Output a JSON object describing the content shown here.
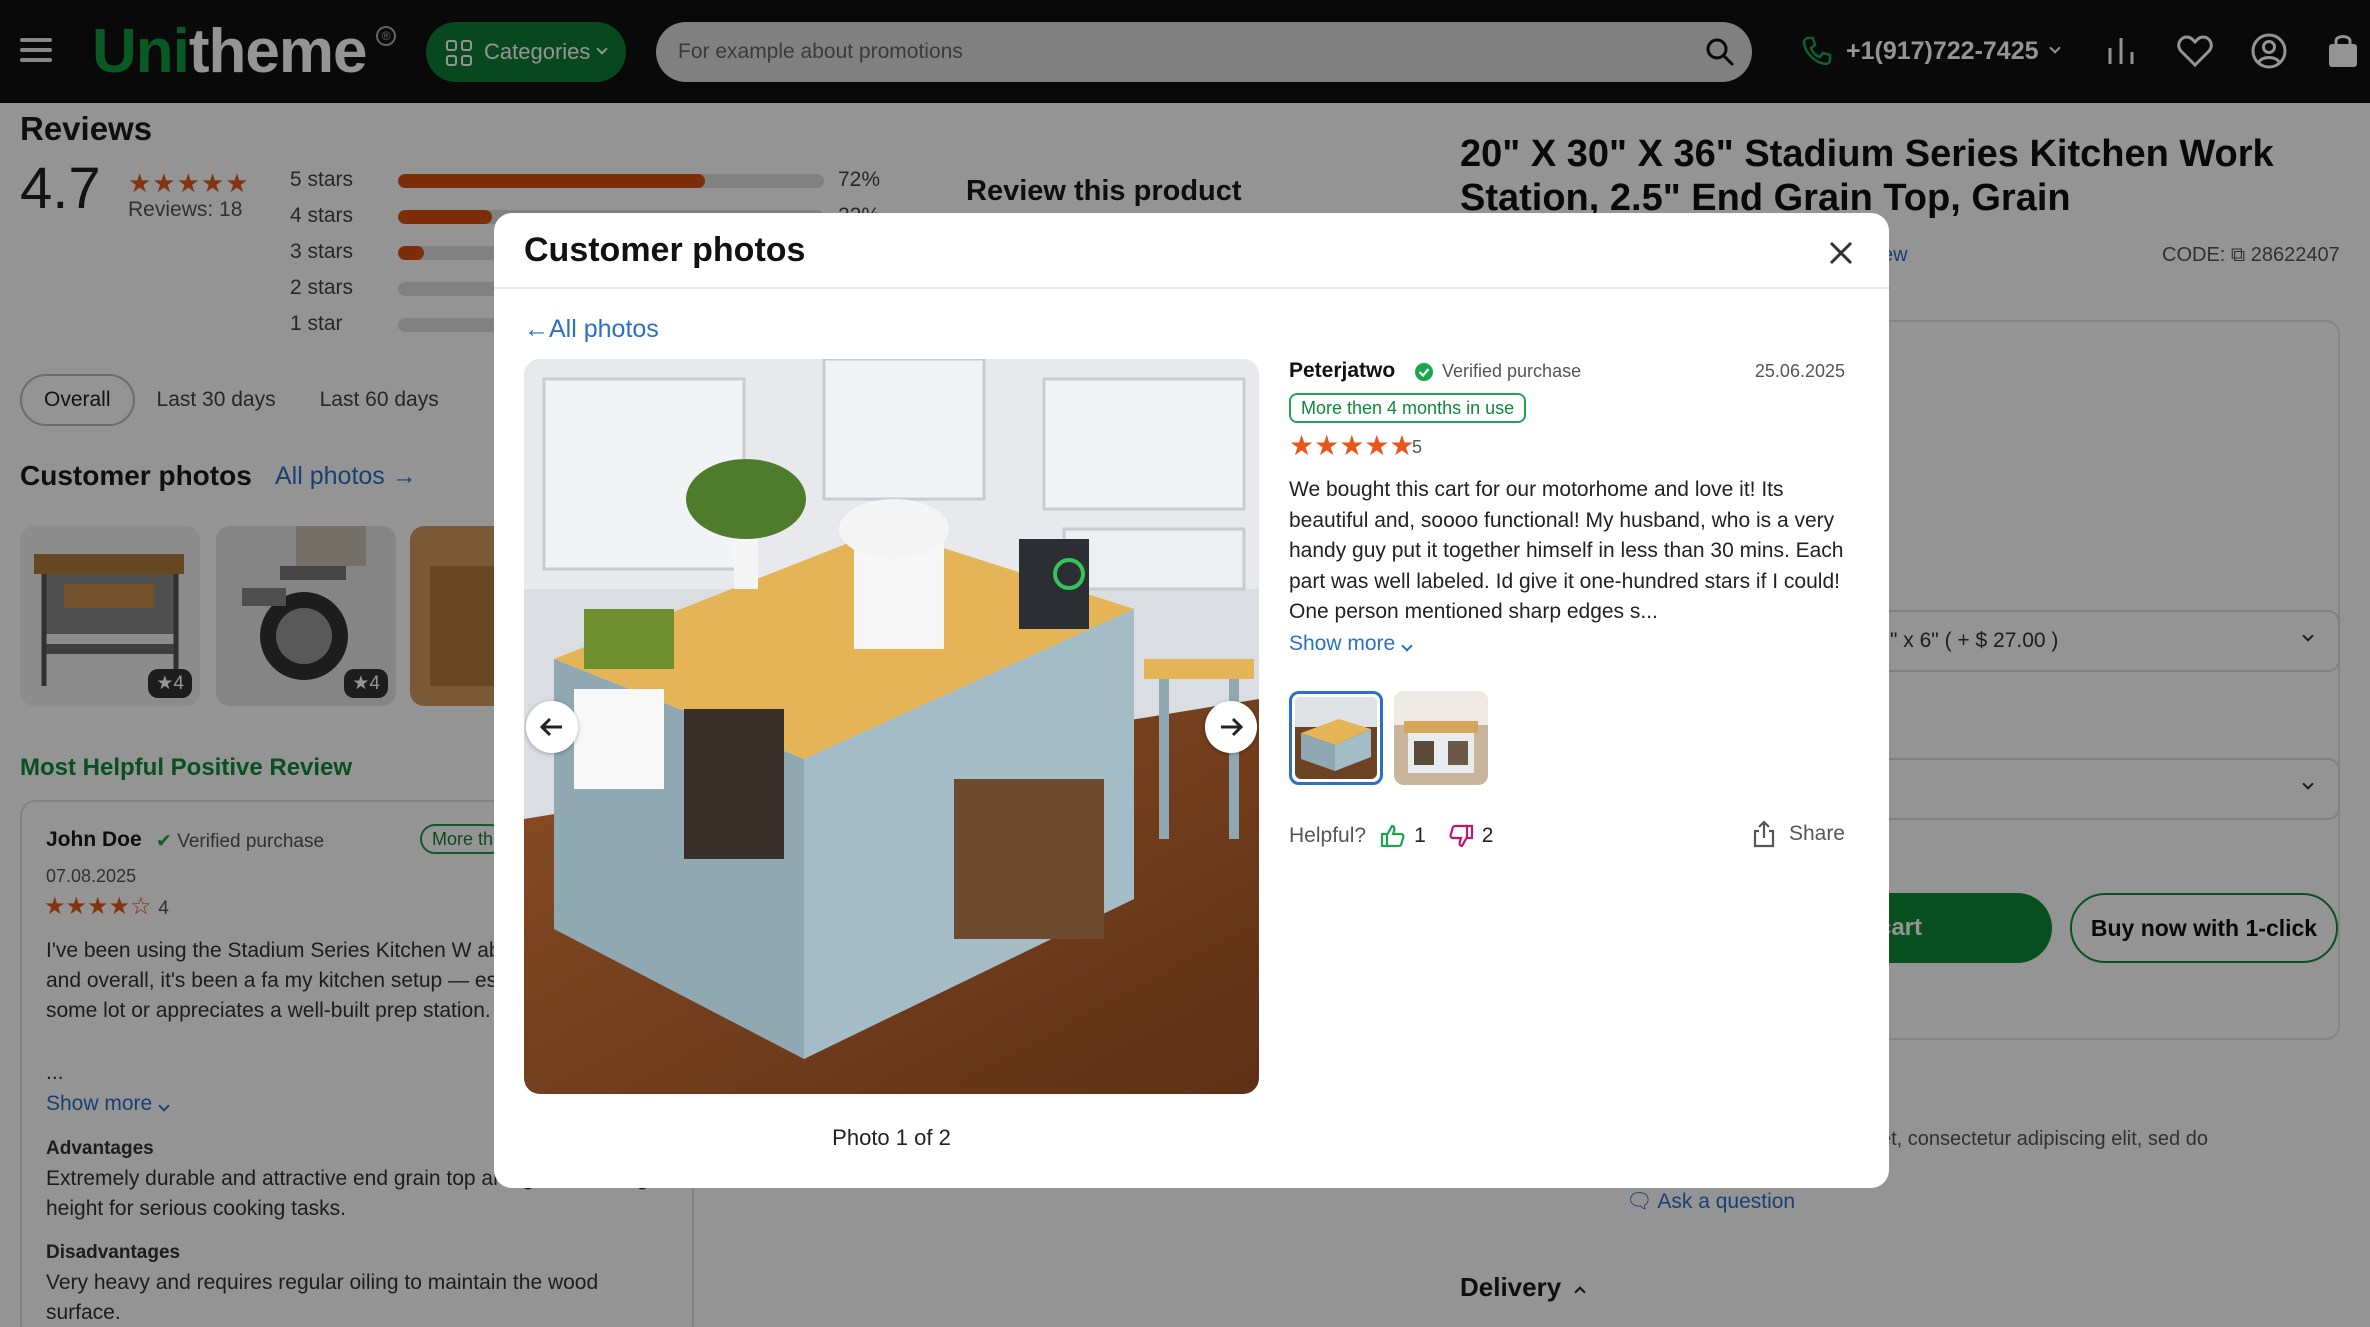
{
  "header": {
    "logo_uni": "Uni",
    "logo_theme": "theme",
    "logo_mark": "®",
    "categories_label": "Categories",
    "search_placeholder": "For example about promotions",
    "phone": "+1(917)722-7425"
  },
  "reviews": {
    "title": "Reviews",
    "rating": "4.7",
    "rating_stars": "★★★★★",
    "count_text": "Reviews: 18",
    "bars": [
      {
        "label": "5 stars",
        "fraction": 0.72,
        "pct": "72%"
      },
      {
        "label": "4 stars",
        "fraction": 0.22,
        "pct": "22%"
      },
      {
        "label": "3 stars",
        "fraction": 0.06,
        "pct": ""
      },
      {
        "label": "2 stars",
        "fraction": 0,
        "pct": ""
      },
      {
        "label": "1 star",
        "fraction": 0,
        "pct": ""
      }
    ],
    "review_this": "Review this product",
    "tabs": [
      "Overall",
      "Last 30 days",
      "Last 60 days"
    ],
    "customer_photos_title": "Customer photos",
    "all_photos_link": "All photos",
    "thumb_badges": [
      "★4",
      "★4"
    ],
    "most_helpful_title": "Most Helpful Positive Review"
  },
  "helpful_review": {
    "name": "John Doe",
    "verified": "Verified purchase",
    "pill": "More th",
    "date": "07.08.2025",
    "stars": "★★★★☆",
    "rating": "4",
    "text": "I've been using the Stadium Series Kitchen W about a month now, and overall, it's been a fa my kitchen setup — especially if you're some lot or appreciates a well-built prep station.",
    "ellipsis": "...",
    "show_more": "Show more",
    "advantages_label": "Advantages",
    "advantages_text": "Extremely durable and attractive end grain top and great working height for serious cooking tasks.",
    "disadvantages_label": "Disadvantages",
    "disadvantages_text": "Very heavy and requires regular oiling to maintain the wood surface."
  },
  "product": {
    "title": "20\" X 30\" X 36\" Stadium Series Kitchen Work Station, 2.5\" End Grain Top, Grain",
    "review_link": "ew",
    "code_label": "CODE:",
    "code": "28622407",
    "option_1": "\" x 6\" ( + $ 27.00 )",
    "cart_btn": "cart",
    "buy_btn": "Buy now with 1-click",
    "lorem": "et, consectetur adipiscing elit, sed do",
    "ask_question": "Ask a question",
    "delivery": "Delivery"
  },
  "modal": {
    "title": "Customer photos",
    "back_link": "All photos",
    "photo_counter": "Photo 1 of 2",
    "reviewer": "Peterjatwo",
    "verified": "Verified purchase",
    "date": "25.06.2025",
    "usage_pill": "More then 4 months in use",
    "stars": "★★★★★",
    "rating": "5",
    "text": "We bought this cart for our motorhome and love it! Its beautiful and, soooo functional! My husband, who is a very handy guy put it together himself in less than 30 mins. Each part was well labeled. Id give it one-hundred stars if I could! One person mentioned sharp edges s...",
    "show_more": "Show more",
    "helpful_label": "Helpful?",
    "likes": "1",
    "dislikes": "2",
    "share": "Share"
  },
  "colors": {
    "brand_green": "#0e9a3e",
    "star_orange": "#e05a1c",
    "link_blue": "#2b6fc6",
    "dislike_magenta": "#c0166b"
  },
  "icons": [
    "menu-icon",
    "grid-icon",
    "search-icon",
    "phone-icon",
    "compare-icon",
    "heart-icon",
    "user-icon",
    "bag-icon",
    "close-icon",
    "arrow-left-icon",
    "arrow-right-icon",
    "check-badge-icon",
    "thumbs-up-icon",
    "thumbs-down-icon",
    "share-icon",
    "copy-icon",
    "question-icon"
  ]
}
